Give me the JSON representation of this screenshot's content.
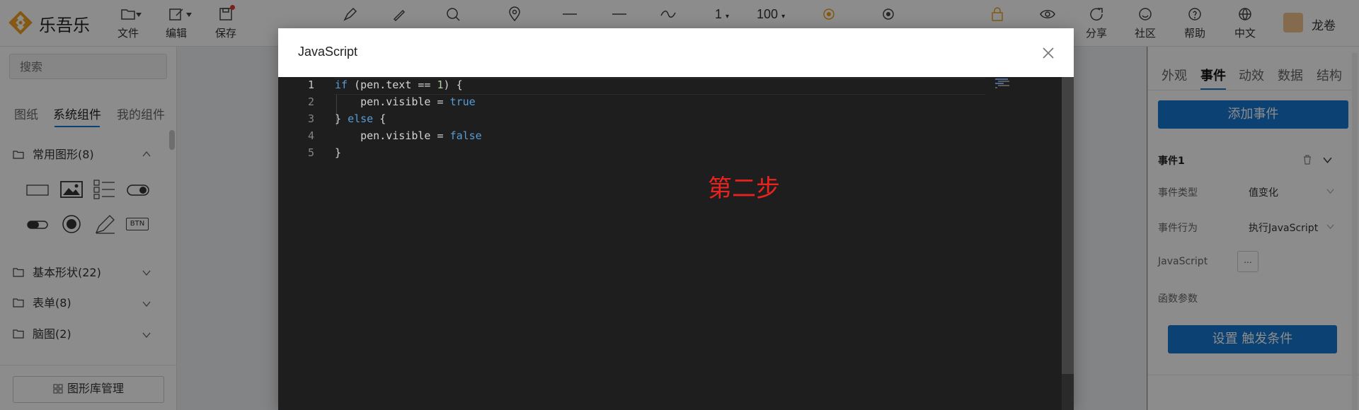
{
  "app": {
    "name": "乐吾乐"
  },
  "toolbar": {
    "file_label": "文件",
    "edit_label": "编辑",
    "save_label": "保存",
    "line_width": "1",
    "zoom": "100",
    "share_label": "分享",
    "community_label": "社区",
    "help_label": "帮助",
    "lang_label": "中文",
    "user_name": "龙卷",
    "accent_color": "#f0a020"
  },
  "left_panel": {
    "search_placeholder": "搜索",
    "tabs": [
      "图纸",
      "系统组件",
      "我的组件"
    ],
    "active_tab": "系统组件",
    "categories": [
      {
        "label": "常用图形(8)",
        "expanded": true
      },
      {
        "label": "基本形状(22)",
        "expanded": false
      },
      {
        "label": "表单(8)",
        "expanded": false
      },
      {
        "label": "脑图(2)",
        "expanded": false
      }
    ],
    "shapes": [
      "rectangle-icon",
      "image-icon",
      "checklist-icon",
      "toggle-on-icon",
      "toggle-off-icon",
      "radio-icon",
      "pen-icon",
      "btn-icon"
    ],
    "btn_shape_text": "BTN",
    "library_button": "图形库管理"
  },
  "right_panel": {
    "tabs": [
      "外观",
      "事件",
      "动效",
      "数据",
      "结构"
    ],
    "active_tab": "事件",
    "add_event_button": "添加事件",
    "event_title": "事件1",
    "event_type_label": "事件类型",
    "event_type_value": "值变化",
    "event_action_label": "事件行为",
    "event_action_value": "执行JavaScript",
    "javascript_label": "JavaScript",
    "javascript_button": "...",
    "func_params_label": "函数参数",
    "trigger_button": "设置 触发条件",
    "primary_color": "#1677d2"
  },
  "modal": {
    "title": "JavaScript",
    "code_lines": [
      {
        "num": "1"
      },
      {
        "num": "2"
      },
      {
        "num": "3"
      },
      {
        "num": "4"
      },
      {
        "num": "5"
      }
    ],
    "annotation": "第二步",
    "annotation_color": "#e8231f",
    "editor_bg": "#1e1e1e",
    "keyword_color": "#569cd6"
  }
}
